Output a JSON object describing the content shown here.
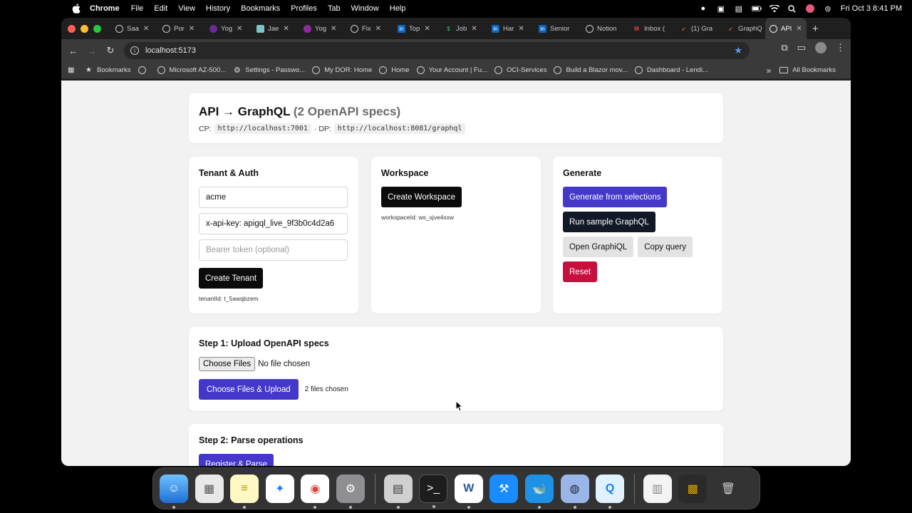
{
  "menubar": {
    "app_name": "Chrome",
    "menus": [
      "File",
      "Edit",
      "View",
      "History",
      "Bookmarks",
      "Profiles",
      "Tab",
      "Window",
      "Help"
    ],
    "clock": "Fri Oct 3  8:41 PM"
  },
  "browser": {
    "tabs": [
      {
        "label": "Saa",
        "icon": "openai-icon"
      },
      {
        "label": "Por",
        "icon": "openai-icon"
      },
      {
        "label": "Yog",
        "icon": "yoga-icon"
      },
      {
        "label": "Jae",
        "icon": "person-icon"
      },
      {
        "label": "Yog",
        "icon": "yoga-icon"
      },
      {
        "label": "Fix",
        "icon": "openai-icon"
      },
      {
        "label": "Top",
        "icon": "linkedin-icon"
      },
      {
        "label": "Job",
        "icon": "dollar-icon"
      },
      {
        "label": "Har",
        "icon": "linkedin-icon"
      },
      {
        "label": "Senior",
        "icon": "linkedin-icon"
      },
      {
        "label": "Notion",
        "icon": "openai-icon"
      },
      {
        "label": "Inbox (",
        "icon": "gmail-icon"
      },
      {
        "label": "(1) Gra",
        "icon": "rocket-icon"
      },
      {
        "label": "GraphQ",
        "icon": "rocket-icon"
      },
      {
        "label": "API",
        "icon": "openai-icon",
        "active": true
      }
    ],
    "url": "localhost:5173",
    "bookmarks": [
      {
        "label": "Bookmarks",
        "icon": "star-icon"
      },
      {
        "label": "",
        "icon": "globe-icon"
      },
      {
        "label": "Microsoft AZ-500...",
        "icon": "globe-icon"
      },
      {
        "label": "Settings - Passwo...",
        "icon": "gear-icon"
      },
      {
        "label": "My DOR: Home",
        "icon": "globe-icon"
      },
      {
        "label": "Home",
        "icon": "globe-icon"
      },
      {
        "label": "Your Account | Fu...",
        "icon": "globe-icon"
      },
      {
        "label": "OCI-Services",
        "icon": "globe-icon"
      },
      {
        "label": "Build a Blazor mov...",
        "icon": "globe-icon"
      },
      {
        "label": "Dashboard - Lendi...",
        "icon": "globe-icon"
      }
    ],
    "all_bookmarks": "All Bookmarks"
  },
  "header": {
    "title": "API → GraphQL",
    "subtitle": "(2 OpenAPI specs)",
    "cp_label": "CP:",
    "cp_url": "http://localhost:7001",
    "dp_label": "· DP:",
    "dp_url": "http://localhost:8081/graphql"
  },
  "tenant": {
    "heading": "Tenant & Auth",
    "tenant_value": "acme",
    "api_key_value": "x-api-key: apigql_live_9f3b0c4d2a6",
    "bearer_placeholder": "Bearer token (optional)",
    "create_label": "Create Tenant",
    "tenant_id": "tenantId: t_5awqbzem"
  },
  "workspace": {
    "heading": "Workspace",
    "create_label": "Create Workspace",
    "workspace_id": "workspaceId: ws_xjve4xxw"
  },
  "generate": {
    "heading": "Generate",
    "generate_label": "Generate from selections",
    "run_label": "Run sample GraphQL",
    "open_label": "Open GraphiQL",
    "copy_label": "Copy query",
    "reset_label": "Reset"
  },
  "step1": {
    "title": "Step 1: Upload OpenAPI specs",
    "choose_files": "Choose Files",
    "no_file": "No file chosen",
    "upload_label": "Choose Files & Upload",
    "files_chosen": "2 files chosen"
  },
  "step2": {
    "title": "Step 2: Parse operations",
    "button_label": "Register & Parse"
  },
  "dock": [
    "finder-icon",
    "launchpad-icon",
    "notes-icon",
    "safari-icon",
    "chrome-icon",
    "settings-icon",
    "calculator-icon",
    "terminal-icon",
    "word-icon",
    "xcode-icon",
    "docker-icon",
    "sim-icon",
    "quicktime-icon",
    "document-icon",
    "screenshot-icon",
    "trash-icon"
  ],
  "colors": {
    "indigo": "#4338ca",
    "black": "#0b0b0b",
    "red": "#c8103e",
    "page_bg": "#f2f2f2"
  }
}
